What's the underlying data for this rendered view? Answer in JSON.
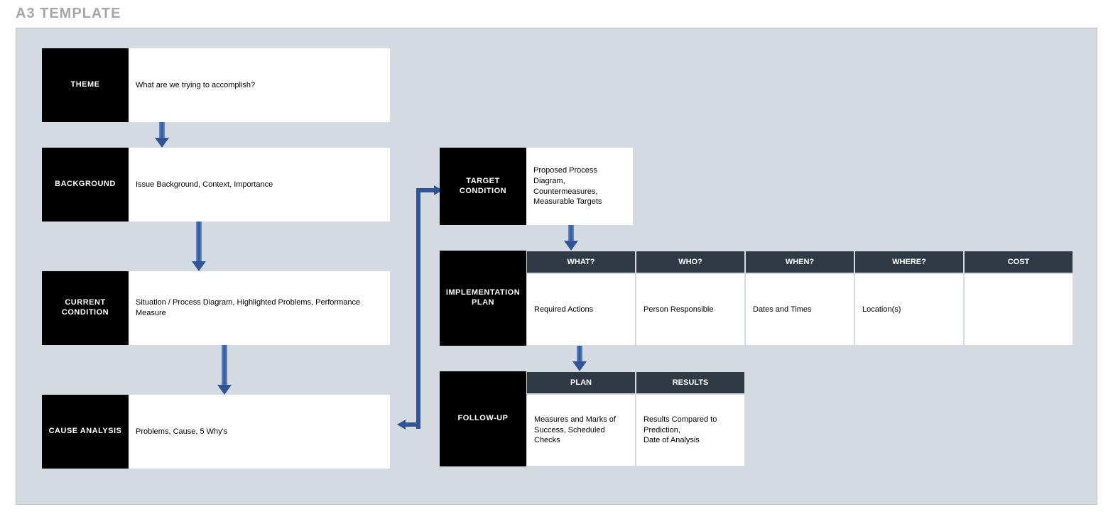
{
  "title": "A3 TEMPLATE",
  "left": {
    "theme": {
      "label": "THEME",
      "content": "What are we trying to accomplish?"
    },
    "background": {
      "label": "BACKGROUND",
      "content": "Issue Background, Context, Importance"
    },
    "current": {
      "label": "CURRENT CONDITION",
      "content": "Situation / Process Diagram, Highlighted Problems, Performance Measure"
    },
    "cause": {
      "label": "CAUSE ANALYSIS",
      "content": "Problems, Cause, 5 Why's"
    }
  },
  "right": {
    "target": {
      "label": "TARGET CONDITION",
      "content": "Proposed Process Diagram, Countermeasures, Measurable Targets"
    },
    "impl": {
      "label": "IMPLEMENTATION PLAN",
      "headers": [
        "WHAT?",
        "WHO?",
        "WHEN?",
        "WHERE?",
        "COST"
      ],
      "cells": [
        "Required Actions",
        "Person Responsible",
        "Dates and Times",
        "Location(s)",
        ""
      ]
    },
    "follow": {
      "label": "FOLLOW-UP",
      "headers": [
        "PLAN",
        "RESULTS"
      ],
      "cells": [
        "Measures and Marks of Success, Scheduled Checks",
        "Results Compared to Prediction,\nDate of Analysis"
      ]
    }
  }
}
